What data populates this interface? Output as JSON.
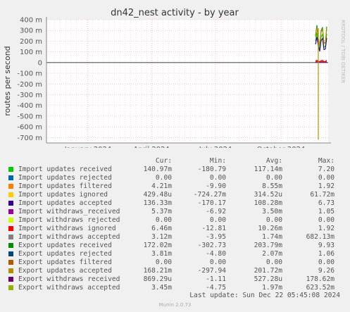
{
  "chart_data": {
    "type": "line",
    "title": "dn42_nest activity - by year",
    "ylabel": "routes per second",
    "ylim": [
      -750,
      400
    ],
    "y_ticks": [
      "400 m",
      "300 m",
      "200 m",
      "100 m",
      "0",
      "-100 m",
      "-200 m",
      "-300 m",
      "-400 m",
      "-500 m",
      "-600 m",
      "-700 m"
    ],
    "x_ticks": [
      "January 2024",
      "April 2024",
      "July 2024",
      "October 2024"
    ],
    "side_label": "RRDTOOL / TOBI OETIKER",
    "grid": true
  },
  "legend": {
    "headers": {
      "cur": "Cur:",
      "min": "Min:",
      "avg": "Avg:",
      "max": "Max:"
    },
    "rows": [
      {
        "name": "Import updates received",
        "color": "#00cc00",
        "cur": "140.97m",
        "min": "-180.79",
        "avg": "117.14m",
        "max": "7.20"
      },
      {
        "name": "Import updates rejected",
        "color": "#0066b3",
        "cur": "0.00",
        "min": "0.00",
        "avg": "0.00",
        "max": "0.00"
      },
      {
        "name": "Import updates filtered",
        "color": "#ff8000",
        "cur": "4.21m",
        "min": "-9.90",
        "avg": "8.55m",
        "max": "1.92"
      },
      {
        "name": "Import updates ignored",
        "color": "#ffcc00",
        "cur": "429.48u",
        "min": "-724.27m",
        "avg": "314.52u",
        "max": "61.72m"
      },
      {
        "name": "Import updates accepted",
        "color": "#330099",
        "cur": "136.33m",
        "min": "-170.17",
        "avg": "108.28m",
        "max": "6.73"
      },
      {
        "name": "Import withdraws_received",
        "color": "#990099",
        "cur": "5.37m",
        "min": "-6.92",
        "avg": "3.50m",
        "max": "1.05"
      },
      {
        "name": "Import withdraws rejected",
        "color": "#ccff00",
        "cur": "0.00",
        "min": "0.00",
        "avg": "0.00",
        "max": "0.00"
      },
      {
        "name": "Import withdraws ignored",
        "color": "#ff0000",
        "cur": "6.46m",
        "min": "-12.81",
        "avg": "10.26m",
        "max": "1.92"
      },
      {
        "name": "Import withdraws accepted",
        "color": "#808080",
        "cur": "3.12m",
        "min": "-3.95",
        "avg": "1.74m",
        "max": "682.13m"
      },
      {
        "name": "Export updates received",
        "color": "#008f00",
        "cur": "172.02m",
        "min": "-302.73",
        "avg": "203.79m",
        "max": "9.93"
      },
      {
        "name": "Export updates rejected",
        "color": "#00487d",
        "cur": "3.81m",
        "min": "-4.80",
        "avg": "2.07m",
        "max": "1.06"
      },
      {
        "name": "Export updates filtered",
        "color": "#b35a00",
        "cur": "0.00",
        "min": "0.00",
        "avg": "0.00",
        "max": "0.00"
      },
      {
        "name": "Export updates accepted",
        "color": "#b38f00",
        "cur": "168.21m",
        "min": "-297.94",
        "avg": "201.72m",
        "max": "9.26"
      },
      {
        "name": "Export withdraws received",
        "color": "#6b006b",
        "cur": "869.29u",
        "min": "-1.11",
        "avg": "527.28u",
        "max": "178.62m"
      },
      {
        "name": "Export withdraws accepted",
        "color": "#8fb300",
        "cur": "3.45m",
        "min": "-4.75",
        "avg": "1.97m",
        "max": "623.52m"
      }
    ]
  },
  "last_update": "Last update: Sun Dec 22 05:45:08 2024",
  "footer": "Munin 2.0.73"
}
